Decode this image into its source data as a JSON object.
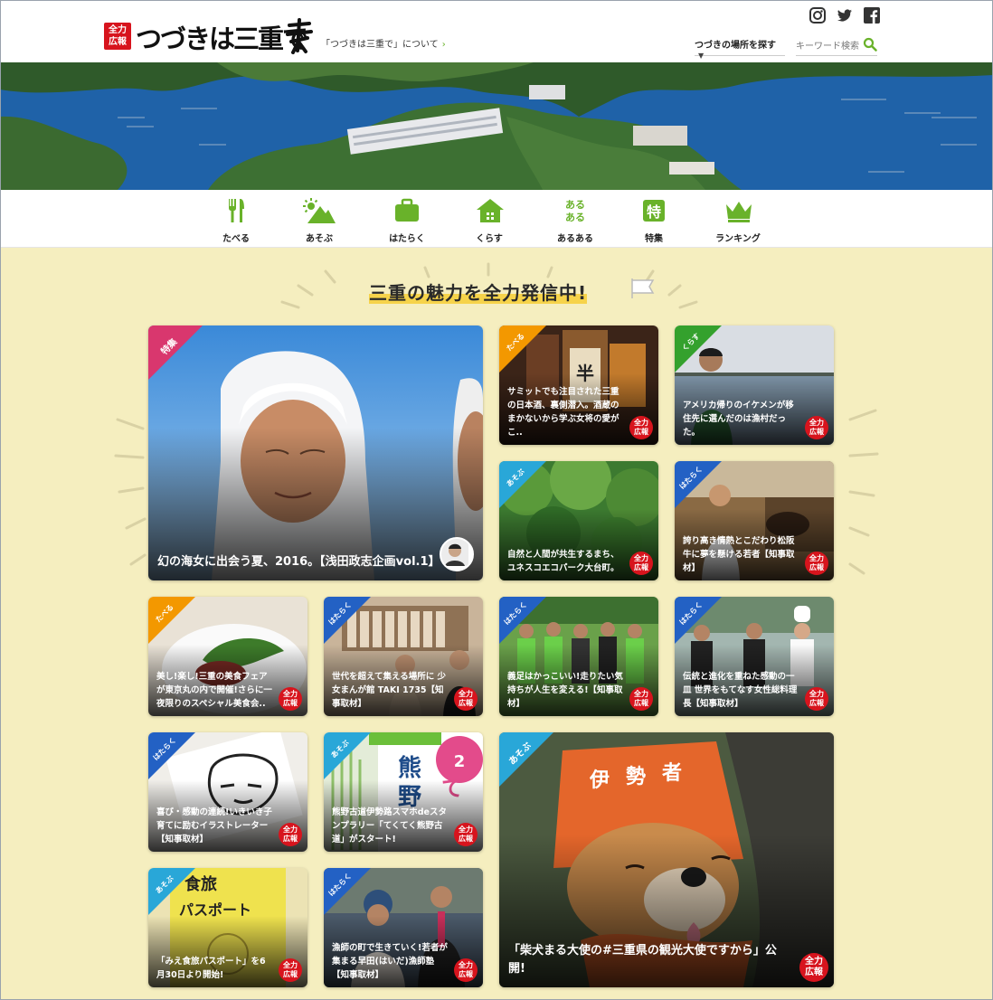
{
  "header": {
    "badge": "全力\n広報",
    "logo_text": "つづきは三重で",
    "about_link": "「つづきは三重で」について",
    "about_chevron": "›",
    "place_select": "つづきの場所を探す",
    "place_arrow": "▼",
    "search_placeholder": "キーワード検索",
    "social": [
      "instagram-icon",
      "twitter-icon",
      "facebook-icon"
    ]
  },
  "nav": {
    "items": [
      {
        "label": "たべる",
        "icon": "fork-knife-icon"
      },
      {
        "label": "あそぶ",
        "icon": "sun-mountain-icon"
      },
      {
        "label": "はたらく",
        "icon": "briefcase-icon"
      },
      {
        "label": "くらす",
        "icon": "house-icon"
      },
      {
        "label": "あるある",
        "icon": "aruaru-icon"
      },
      {
        "label": "特集",
        "icon": "special-icon"
      },
      {
        "label": "ランキング",
        "icon": "crown-icon"
      }
    ]
  },
  "main": {
    "headline": "三重の魅力を全力発信中!",
    "badge_text": "全力\n広報",
    "cards": [
      {
        "category": "特集",
        "title": "幻の海女に出会う夏、2016。【浅田政志企画vol.1】"
      },
      {
        "category": "たべる",
        "title": "サミットでも注目された三重の日本酒、裏側潜入。酒蔵のまかないから学ぶ女将の愛がこ.."
      },
      {
        "category": "くらす",
        "title": "アメリカ帰りのイケメンが移住先に選んだのは漁村だった。"
      },
      {
        "category": "あそぶ",
        "title": "自然と人間が共生するまち、ユネスコエコパーク大台町。"
      },
      {
        "category": "はたらく",
        "title": "誇り高き情熱とこだわり松阪牛に夢を懸ける若者【知事取材】"
      },
      {
        "category": "たべる",
        "title": "美し!楽し!三重の美食フェアが東京丸の内で開催!さらに一夜限りのスペシャル美食会.."
      },
      {
        "category": "はたらく",
        "title": "世代を超えて集える場所に 少女まんが館 TAKI 1735【知事取材】"
      },
      {
        "category": "はたらく",
        "title": "義足はかっこいい!走りたい気持ちが人生を変える!【知事取材】"
      },
      {
        "category": "はたらく",
        "title": "伝統と進化を重ねた感動の一皿 世界をもてなす女性総料理長【知事取材】"
      },
      {
        "category": "はたらく",
        "title": "喜び・感動の連続!いきいき子育てに励むイラストレーター【知事取材】"
      },
      {
        "category": "あそぶ",
        "title": "熊野古道伊勢路スマホdeスタンプラリー「てくてく熊野古道」がスタート!"
      },
      {
        "category": "あそぶ",
        "title": "「柴犬まる大使の#三重県の観光大使ですから」公開!"
      },
      {
        "category": "あそぶ",
        "title": "「みえ食旅パスポート」を6月30日より開始!"
      },
      {
        "category": "はたらく",
        "title": "漁師の町で生きていく!若者が集まる早田(はいだ)漁師塾【知事取材】"
      }
    ]
  },
  "colors": {
    "green": "#69b22a",
    "red": "#d7141d",
    "tokushu": "#d9376e",
    "taberu": "#f39800",
    "asobu": "#29a7d8",
    "hataraku": "#2361c4",
    "kurasu": "#34a12d",
    "background": "#f5eebf"
  }
}
